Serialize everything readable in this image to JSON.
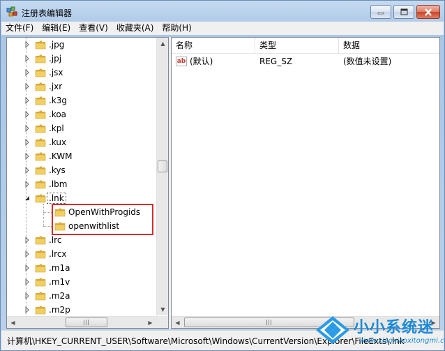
{
  "window": {
    "title": "注册表编辑器"
  },
  "menu": [
    "文件(F)",
    "编辑(E)",
    "查看(V)",
    "收藏夹(A)",
    "帮助(H)"
  ],
  "tree": {
    "items": [
      {
        "label": ".jpg",
        "level": 1,
        "expander": "collapsed"
      },
      {
        "label": ".jpj",
        "level": 1,
        "expander": "collapsed"
      },
      {
        "label": ".jsx",
        "level": 1,
        "expander": "collapsed"
      },
      {
        "label": ".jxr",
        "level": 1,
        "expander": "collapsed"
      },
      {
        "label": ".k3g",
        "level": 1,
        "expander": "collapsed"
      },
      {
        "label": ".koa",
        "level": 1,
        "expander": "collapsed"
      },
      {
        "label": ".kpl",
        "level": 1,
        "expander": "collapsed"
      },
      {
        "label": ".kux",
        "level": 1,
        "expander": "collapsed"
      },
      {
        "label": ".KWM",
        "level": 1,
        "expander": "collapsed"
      },
      {
        "label": ".kys",
        "level": 1,
        "expander": "collapsed"
      },
      {
        "label": ".lbm",
        "level": 1,
        "expander": "collapsed"
      },
      {
        "label": ".lnk",
        "level": 1,
        "expander": "expanded",
        "selected": true
      },
      {
        "label": "OpenWithProgids",
        "level": 2,
        "expander": "none"
      },
      {
        "label": "openwithlist",
        "level": 2,
        "expander": "none"
      },
      {
        "label": ".lrc",
        "level": 1,
        "expander": "collapsed"
      },
      {
        "label": ".lrcx",
        "level": 1,
        "expander": "collapsed"
      },
      {
        "label": ".m1a",
        "level": 1,
        "expander": "collapsed"
      },
      {
        "label": ".m1v",
        "level": 1,
        "expander": "collapsed"
      },
      {
        "label": ".m2a",
        "level": 1,
        "expander": "collapsed"
      },
      {
        "label": ".m2p",
        "level": 1,
        "expander": "collapsed"
      }
    ]
  },
  "list": {
    "columns": [
      "名称",
      "类型",
      "数据"
    ],
    "rows": [
      {
        "name": "(默认)",
        "type": "REG_SZ",
        "data": "(数值未设置)",
        "icon": "ab-string-icon"
      }
    ]
  },
  "status": {
    "path": "计算机\\HKEY_CURRENT_USER\\Software\\Microsoft\\Windows\\CurrentVersion\\Explorer\\FileExts\\.lnk"
  },
  "watermark": {
    "title": "小小系统迷",
    "url": "www.xiaoxiaoxitongmi.com"
  },
  "colors": {
    "highlight_border": "#d62c2c",
    "folder": "#e8c25a",
    "watermark": "#1a8ad8"
  }
}
